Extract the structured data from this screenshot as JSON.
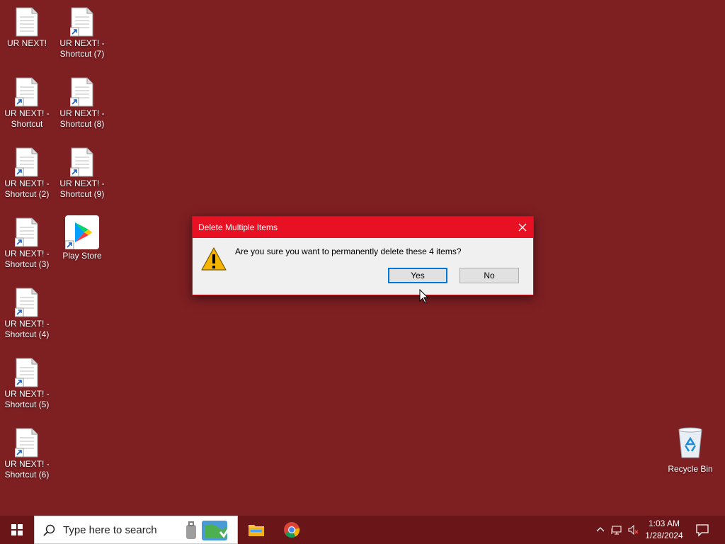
{
  "desktop": {
    "icons": [
      {
        "label": "UR NEXT!",
        "shortcut": false
      },
      {
        "label": "UR NEXT! -\nShortcut",
        "shortcut": true
      },
      {
        "label": "UR NEXT! -\nShortcut (2)",
        "shortcut": true
      },
      {
        "label": "UR NEXT! -\nShortcut (3)",
        "shortcut": true
      },
      {
        "label": "UR NEXT! -\nShortcut (4)",
        "shortcut": true
      },
      {
        "label": "UR NEXT! -\nShortcut (5)",
        "shortcut": true
      },
      {
        "label": "UR NEXT! -\nShortcut (6)",
        "shortcut": true
      },
      {
        "label": "UR NEXT! -\nShortcut (7)",
        "shortcut": true
      },
      {
        "label": "UR NEXT! -\nShortcut (8)",
        "shortcut": true
      },
      {
        "label": "UR NEXT! -\nShortcut (9)",
        "shortcut": true
      },
      {
        "label": "Play Store",
        "shortcut": true
      }
    ],
    "recycle_bin": {
      "label": "Recycle Bin"
    }
  },
  "dialog": {
    "title": "Delete Multiple Items",
    "message": "Are you sure you want to permanently delete these 4 items?",
    "yes_label": "Yes",
    "no_label": "No"
  },
  "taskbar": {
    "search_placeholder": "Type here to search",
    "apps": [
      "file-explorer-icon",
      "chrome-icon"
    ],
    "clock_time": "1:03 AM",
    "clock_date": "1/28/2024"
  },
  "colors": {
    "desktop_bg": "#7e1f22",
    "taskbar_bg": "#6a1517",
    "dialog_title_bg": "#e81123",
    "accent": "#0078d7"
  }
}
